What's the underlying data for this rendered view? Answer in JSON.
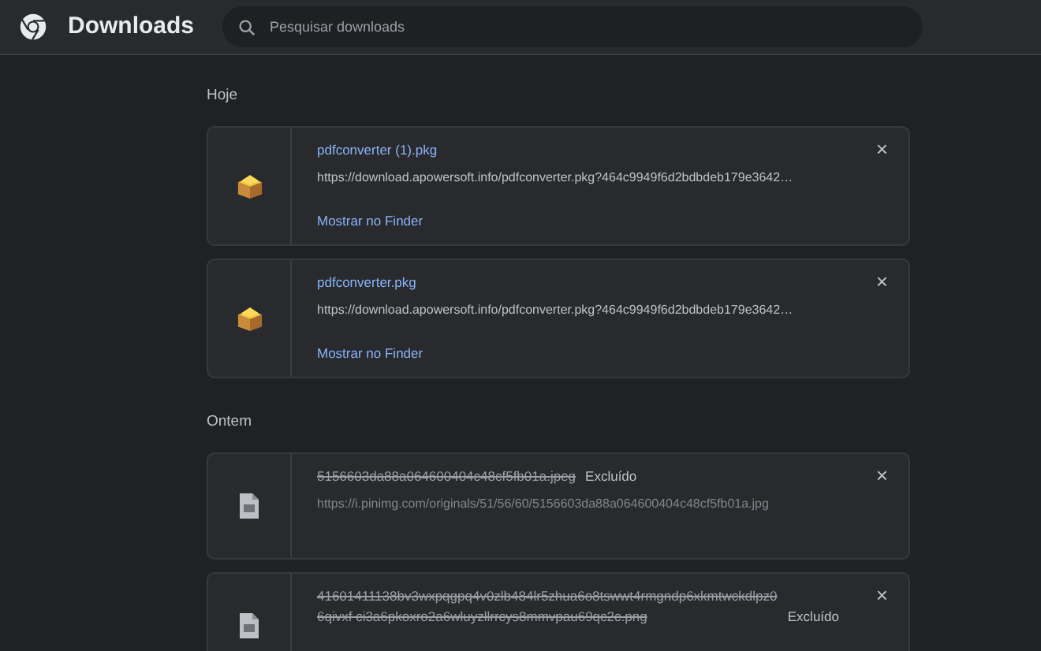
{
  "header": {
    "title": "Downloads",
    "search": {
      "placeholder": "Pesquisar downloads"
    }
  },
  "sections": [
    {
      "label": "Hoje",
      "items": [
        {
          "kind": "package",
          "deleted": false,
          "name": "pdfconverter (1).pkg",
          "url": "https://download.apowersoft.info/pdfconverter.pkg?464c9949f6d2bdbdeb179e3642…",
          "action": "Mostrar no Finder",
          "close": "×"
        },
        {
          "kind": "package",
          "deleted": false,
          "name": "pdfconverter.pkg",
          "url": "https://download.apowersoft.info/pdfconverter.pkg?464c9949f6d2bdbdeb179e3642…",
          "action": "Mostrar no Finder",
          "close": "×"
        }
      ]
    },
    {
      "label": "Ontem",
      "items": [
        {
          "kind": "file",
          "deleted": true,
          "name": "5156603da88a064600404c48cf5fb01a.jpeg",
          "status": "Excluído",
          "url": "https://i.pinimg.com/originals/51/56/60/5156603da88a064600404c48cf5fb01a.jpg",
          "close": "×"
        },
        {
          "kind": "file",
          "deleted": true,
          "name": "41601411138bv3wxpqgpq4v0zlb484lr5zhua6o8tswwt4rmgndp6xkmtwckdlpz06qivxf ci3a6pkoxro2a6wluyzllrrcys8mmvpau69qc2c.png",
          "status": "Excluído",
          "close": "×"
        }
      ]
    }
  ]
}
